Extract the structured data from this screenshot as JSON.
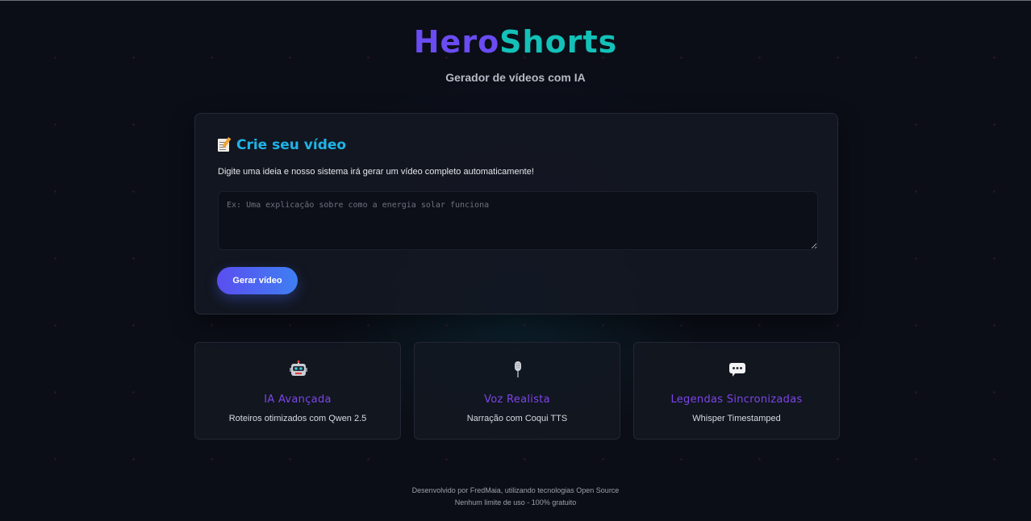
{
  "header": {
    "logo_part_1": "Hero",
    "logo_part_2": "Shorts",
    "subtitle": "Gerador de vídeos com IA"
  },
  "create_card": {
    "title": "Crie seu vídeo",
    "title_icon": "memo-icon",
    "description": "Digite uma ideia e nosso sistema irá gerar um vídeo completo automaticamente!",
    "input_value": "",
    "input_placeholder": "Ex: Uma explicação sobre como a energia solar funciona",
    "button_label": "Gerar vídeo"
  },
  "features": [
    {
      "icon": "robot-icon",
      "title": "IA Avançada",
      "description": "Roteiros otimizados com Qwen 2.5"
    },
    {
      "icon": "microphone-icon",
      "title": "Voz Realista",
      "description": "Narração com Coqui TTS"
    },
    {
      "icon": "speech-bubble-icon",
      "title": "Legendas Sincronizadas",
      "description": "Whisper Timestamped"
    }
  ],
  "footer": {
    "line1": "Desenvolvido por FredMaia, utilizando tecnologias Open Source",
    "line2": "Nenhum limite de uso - 100% gratuito"
  },
  "colors": {
    "background": "#0b0e17",
    "logo_primary": "#6a4cf2",
    "logo_secondary": "#13c1b8",
    "card_title": "#1fb4e8",
    "feature_title": "#7e45e8",
    "button_gradient_start": "#5a4ef0",
    "button_gradient_end": "#3f7ff2"
  }
}
